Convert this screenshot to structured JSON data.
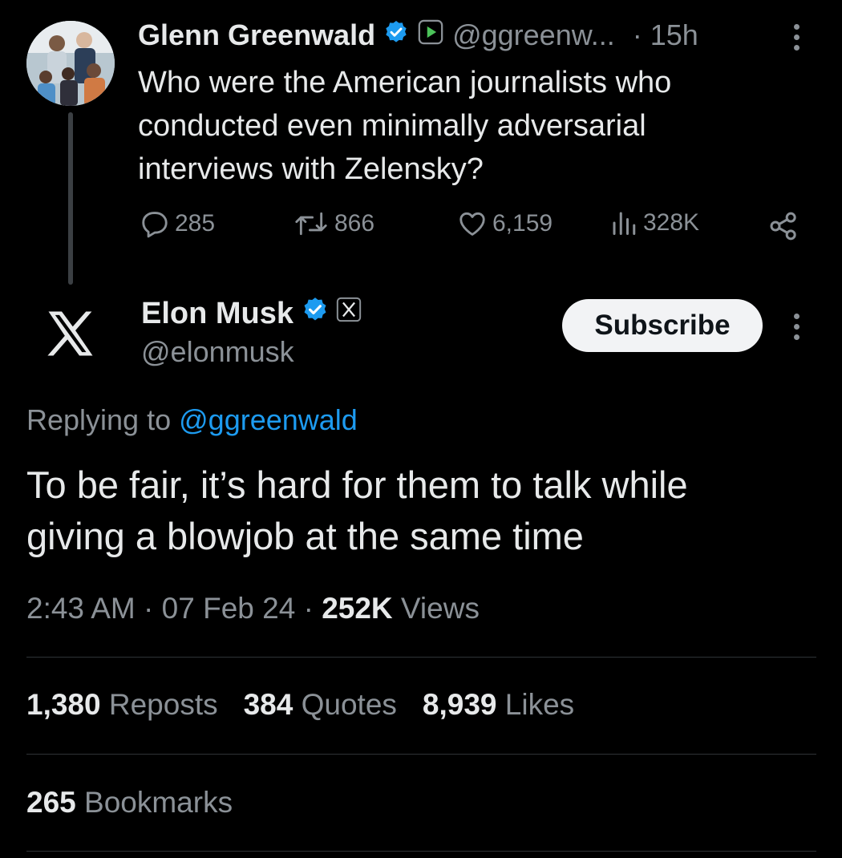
{
  "quoted": {
    "name": "Glenn Greenwald",
    "handle": "@ggreenw...",
    "time": "· 15h",
    "text_lines": [
      "Who were the American journalists who",
      "conducted even minimally adversarial",
      "interviews with Zelensky?"
    ],
    "replies": "285",
    "reposts": "866",
    "likes": "6,159",
    "views": "328K"
  },
  "tweet": {
    "name": "Elon Musk",
    "handle": "@elonmusk",
    "subscribe_label": "Subscribe",
    "replying_prefix": "Replying to",
    "replying_handle": "@ggreenwald",
    "text_lines": [
      "To be fair, it’s hard for them to talk while",
      "giving a blowjob at the same time"
    ],
    "time": "2:43 AM",
    "date": "07 Feb 24",
    "views_count": "252K",
    "views_label": "Views",
    "sep": "·"
  },
  "stats": {
    "reposts_count": "1,380",
    "reposts_label": "Reposts",
    "quotes_count": "384",
    "quotes_label": "Quotes",
    "likes_count": "8,939",
    "likes_label": "Likes",
    "bookmarks_count": "265",
    "bookmarks_label": "Bookmarks"
  },
  "colors": {
    "background": "#000000",
    "text": "#e7e9ea",
    "muted": "#8b9197",
    "link": "#1d9bf0",
    "verified": "#1d9bf0"
  },
  "icons": [
    "verified-badge-icon",
    "subscription-badge-icon",
    "more-icon",
    "reply-icon",
    "repost-icon",
    "like-icon",
    "views-icon",
    "share-icon",
    "x-logo-icon",
    "x-affiliate-badge-icon"
  ]
}
